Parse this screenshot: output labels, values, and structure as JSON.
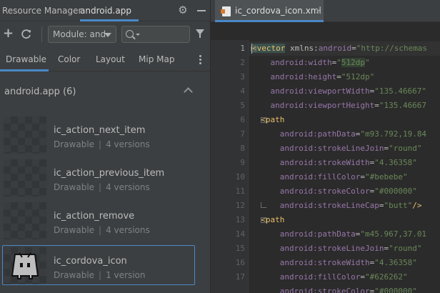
{
  "colors": {
    "accent": "#4a88c7",
    "panel_bg": "#3c3f41",
    "editor_bg": "#2b2b2b",
    "xml_tag": "#e8bf6a",
    "xml_attr": "#9876aa",
    "xml_value": "#6a8759"
  },
  "resource_manager": {
    "title": "Resource Manager",
    "module_tab": "android.app",
    "icons": [
      "gear-icon",
      "minimize-icon"
    ],
    "toolbar": {
      "add_icon": "plus-icon",
      "refresh_icon": "refresh-icon",
      "module_select": "Module: and",
      "search_value": "",
      "filter_icon": "filter-icon"
    },
    "tabs": [
      {
        "label": "Drawable",
        "active": true
      },
      {
        "label": "Color",
        "active": false
      },
      {
        "label": "Layout",
        "active": false
      },
      {
        "label": "Mip Map",
        "active": false
      }
    ],
    "group": {
      "title": "android.app (6)"
    },
    "resources": [
      {
        "name": "ic_action_next_item",
        "type": "Drawable",
        "versions": "4 versions",
        "selected": false
      },
      {
        "name": "ic_action_previous_item",
        "type": "Drawable",
        "versions": "4 versions",
        "selected": false
      },
      {
        "name": "ic_action_remove",
        "type": "Drawable",
        "versions": "4 versions",
        "selected": false
      },
      {
        "name": "ic_cordova_icon",
        "type": "Drawable",
        "versions": "1 version",
        "selected": true
      }
    ]
  },
  "editor": {
    "file_tab": "ic_cordova_icon.xml",
    "current_line": 1,
    "line_numbers": [
      "1",
      "2",
      "3",
      "4",
      "5",
      "6",
      "7",
      "8",
      "9",
      "10",
      "11",
      "12",
      "13",
      "14",
      "15",
      "16",
      "17"
    ],
    "lines": [
      {
        "indent": "",
        "tag": "<vector",
        "attrs": [
          {
            "ns": "xmlns:",
            "name": "android",
            "val": "\"http://schemas"
          }
        ]
      },
      {
        "indent": "    ",
        "attrs": [
          {
            "ns": "android",
            "name": ":width",
            "val": "\"512dp\""
          }
        ]
      },
      {
        "indent": "    ",
        "attrs": [
          {
            "ns": "android",
            "name": ":height",
            "val": "\"512dp\""
          }
        ]
      },
      {
        "indent": "    ",
        "attrs": [
          {
            "ns": "android",
            "name": ":viewportWidth",
            "val": "\"135.46667\""
          }
        ]
      },
      {
        "indent": "    ",
        "attrs": [
          {
            "ns": "android",
            "name": ":viewportHeight",
            "val": "\"135.46667"
          }
        ]
      },
      {
        "indent": "  ",
        "tag": "<path"
      },
      {
        "indent": "      ",
        "attrs": [
          {
            "ns": "android",
            "name": ":pathData",
            "val": "\"m93.792,19.84"
          }
        ]
      },
      {
        "indent": "      ",
        "attrs": [
          {
            "ns": "android",
            "name": ":strokeLineJoin",
            "val": "\"round\""
          }
        ]
      },
      {
        "indent": "      ",
        "attrs": [
          {
            "ns": "android",
            "name": ":strokeWidth",
            "val": "\"4.36358\""
          }
        ]
      },
      {
        "indent": "      ",
        "attrs": [
          {
            "ns": "android",
            "name": ":fillColor",
            "val": "\"#bebebe\""
          }
        ]
      },
      {
        "indent": "      ",
        "attrs": [
          {
            "ns": "android",
            "name": ":strokeColor",
            "val": "\"#000000\""
          }
        ]
      },
      {
        "indent": "      ",
        "attrs": [
          {
            "ns": "android",
            "name": ":strokeLineCap",
            "val": "\"butt\""
          }
        ],
        "close": "/>"
      },
      {
        "indent": "  ",
        "tag": "<path"
      },
      {
        "indent": "      ",
        "attrs": [
          {
            "ns": "android",
            "name": ":pathData",
            "val": "\"m45.967,37.01"
          }
        ]
      },
      {
        "indent": "      ",
        "attrs": [
          {
            "ns": "android",
            "name": ":strokeLineJoin",
            "val": "\"round\""
          }
        ]
      },
      {
        "indent": "      ",
        "attrs": [
          {
            "ns": "android",
            "name": ":strokeWidth",
            "val": "\"4.36358\""
          }
        ]
      },
      {
        "indent": "      ",
        "attrs": [
          {
            "ns": "android",
            "name": ":fillColor",
            "val": "\"#626262\""
          }
        ]
      },
      {
        "indent": "      ",
        "attrs": [
          {
            "ns": "android",
            "name": ":strokeColor",
            "val": "\"#000000\""
          }
        ]
      }
    ]
  }
}
